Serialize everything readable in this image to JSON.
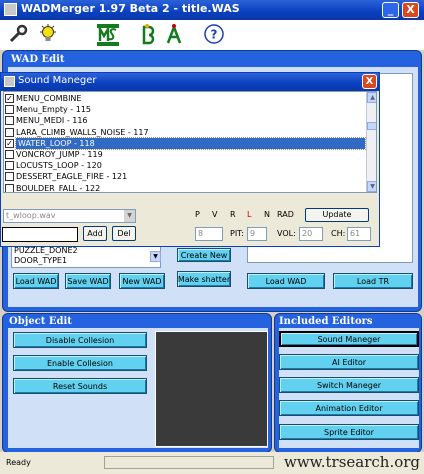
{
  "window": {
    "title": "WADMerger 1.97 Beta 2 - title.WAS",
    "min_label": "_",
    "close_label": "X"
  },
  "toolbar": {
    "icons": [
      "wrench-icon",
      "lightbulb-icon",
      "wad-tool-icon",
      "green-letters-icon",
      "help-icon"
    ],
    "help_glyph": "?"
  },
  "wad_edit": {
    "title": "WAD Edit",
    "left_list": [
      "PUZZLE_DONE2",
      "DOOR_TYPE1"
    ],
    "buttons": {
      "create_new": "Create New",
      "load_wad": "Load WAD",
      "save_wad": "Save WAD",
      "new_wad": "New WAD",
      "make_shatter": "Make shatter",
      "load_wad_right": "Load WAD",
      "load_tr": "Load TR"
    }
  },
  "dialog": {
    "title": "Sound Maneger",
    "close_label": "X",
    "items": [
      {
        "label": "MENU_COMBINE",
        "checked": true,
        "selected": false
      },
      {
        "label": "Menu_Empty - 115",
        "checked": false,
        "selected": false
      },
      {
        "label": "MENU_MEDI - 116",
        "checked": false,
        "selected": false
      },
      {
        "label": "LARA_CLIMB_WALLS_NOISE - 117",
        "checked": false,
        "selected": false
      },
      {
        "label": "WATER_LOOP - 118",
        "checked": true,
        "selected": true
      },
      {
        "label": "VONCROY_JUMP - 119",
        "checked": false,
        "selected": false
      },
      {
        "label": "LOCUSTS_LOOP - 120",
        "checked": false,
        "selected": false
      },
      {
        "label": "DESSERT_EAGLE_FIRE - 121",
        "checked": false,
        "selected": false
      },
      {
        "label": "BOULDER_FALL - 122",
        "checked": false,
        "selected": false
      }
    ],
    "wav_file": "t_wloop.wav",
    "name_value": "",
    "add_label": "Add",
    "del_label": "Del",
    "flags": {
      "p": "P",
      "v": "V",
      "r": "R",
      "l": "L",
      "n": "N",
      "rad": "RAD"
    },
    "update_label": "Update",
    "pit_label": "PIT:",
    "vol_label": "VOL:",
    "ch_label": "CH:",
    "first_value": "8",
    "pit_value": "9",
    "vol_value": "20",
    "ch_value": "61",
    "colors": {
      "r_flag": "#cc0000",
      "selection": "#316ac5"
    }
  },
  "object_edit": {
    "title": "Object Edit",
    "buttons": {
      "disable": "Disable Collesion",
      "enable": "Enable Collesion",
      "reset": "Reset Sounds"
    }
  },
  "included_editors": {
    "title": "Included Editors",
    "buttons": [
      "Sound Maneger",
      "AI Editor",
      "Switch Maneger",
      "Animation Editor",
      "Sprite Editor"
    ]
  },
  "status": {
    "text": "Ready",
    "watermark": "www.trsearch.org"
  },
  "colors": {
    "panel_blue": "#2462e0",
    "button_cyan": "#62d1ef",
    "titlebar_blue": "#0a3fbf"
  }
}
